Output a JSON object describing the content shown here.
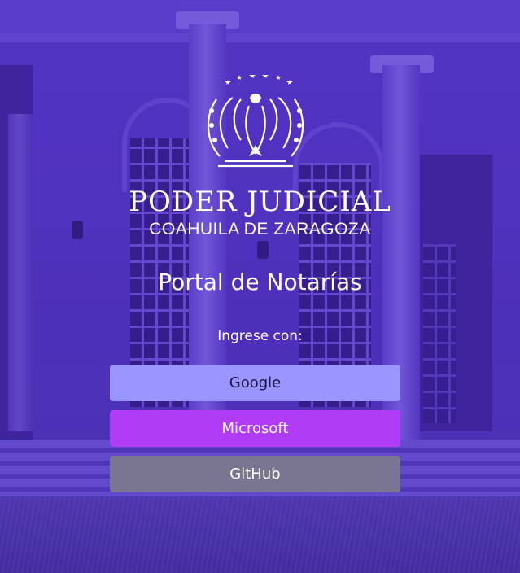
{
  "header": {
    "institution": "PODER JUDICIAL",
    "state": "COAHUILA DE ZARAGOZA",
    "logo_icon": "coat-of-arms-eagle-icon"
  },
  "main": {
    "title": "Portal de Notarías",
    "prompt": "Ingrese con:",
    "buttons": [
      {
        "label": "Google",
        "color": "#9b96ff"
      },
      {
        "label": "Microsoft",
        "color": "#b03cf5"
      },
      {
        "label": "GitHub",
        "color": "#7a7590"
      }
    ]
  },
  "colors": {
    "overlay": "#4a2fb0",
    "text": "#ffffff"
  }
}
